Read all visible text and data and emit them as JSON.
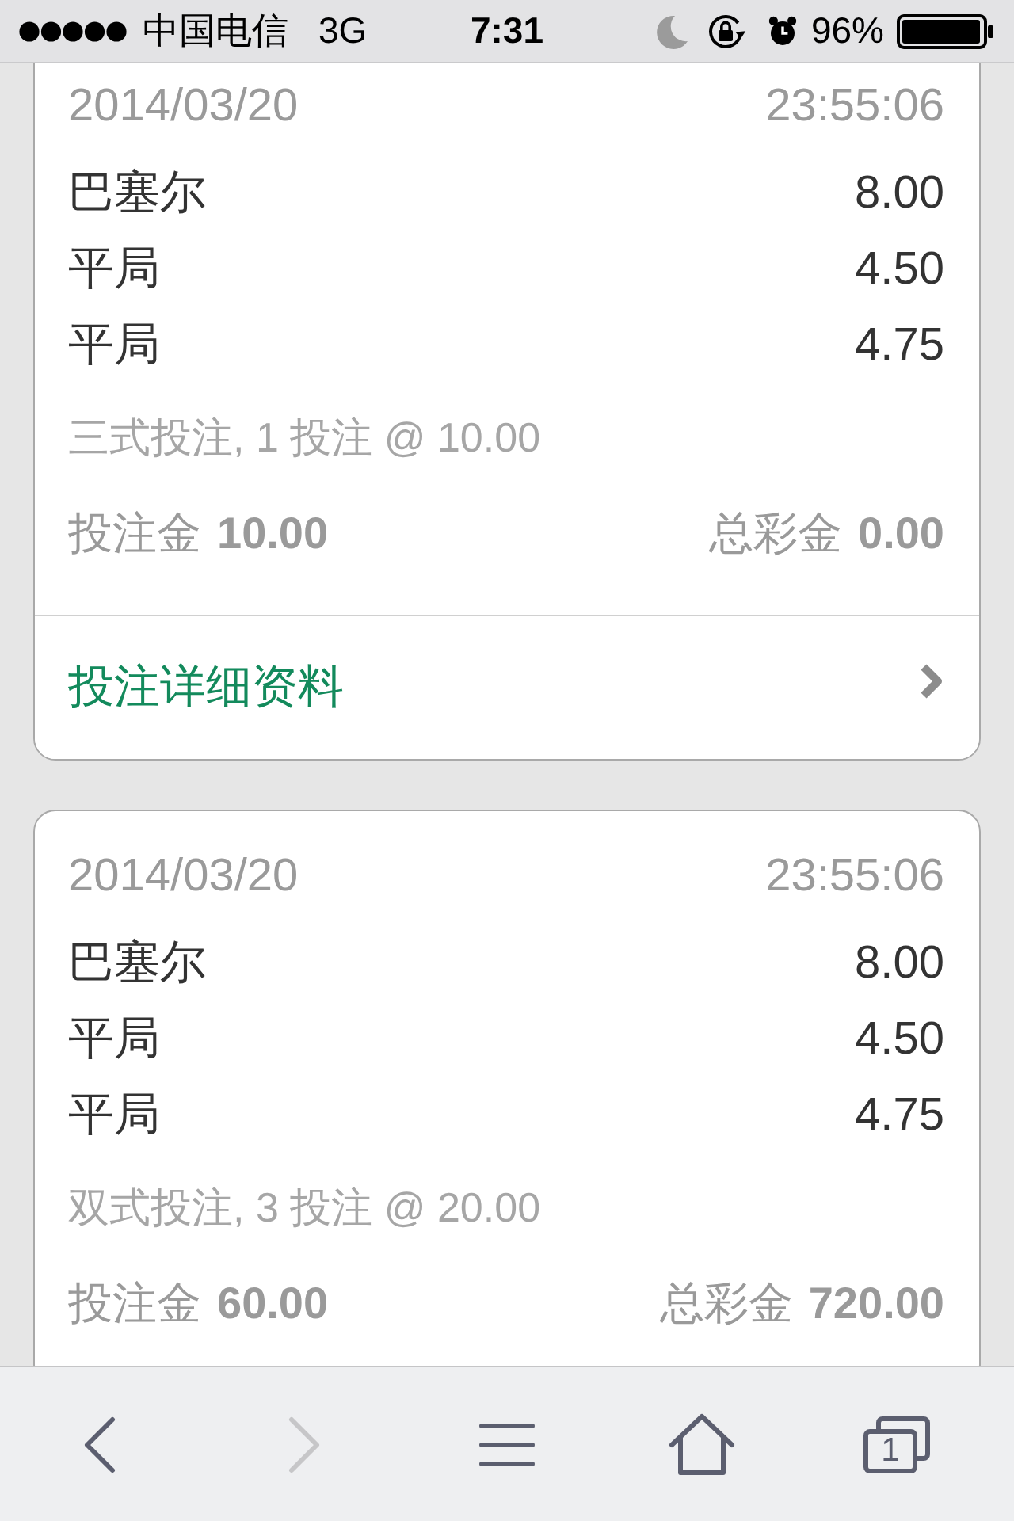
{
  "status_bar": {
    "carrier": "中国电信",
    "network": "3G",
    "time": "7:31",
    "battery": "96%"
  },
  "bets": [
    {
      "date": "2014/03/20",
      "time": "23:55:06",
      "selections": [
        {
          "team": "巴塞尔",
          "odds": "8.00"
        },
        {
          "team": "平局",
          "odds": "4.50"
        },
        {
          "team": "平局",
          "odds": "4.75"
        }
      ],
      "summary": "三式投注, 1 投注 @ 10.00",
      "stake_label": "投注金",
      "stake": "10.00",
      "return_label": "总彩金",
      "return": "0.00",
      "details_link": "投注详细资料"
    },
    {
      "date": "2014/03/20",
      "time": "23:55:06",
      "selections": [
        {
          "team": "巴塞尔",
          "odds": "8.00"
        },
        {
          "team": "平局",
          "odds": "4.50"
        },
        {
          "team": "平局",
          "odds": "4.75"
        }
      ],
      "summary": "双式投注, 3 投注 @ 20.00",
      "stake_label": "投注金",
      "stake": "60.00",
      "return_label": "总彩金",
      "return": "720.00"
    }
  ],
  "toolbar": {
    "buttons": [
      {
        "kind": "back",
        "disabled": false
      },
      {
        "kind": "forward",
        "disabled": true
      },
      {
        "kind": "menu",
        "disabled": false
      },
      {
        "kind": "home",
        "disabled": false
      },
      {
        "kind": "tabs",
        "disabled": false,
        "count": "1"
      }
    ]
  }
}
